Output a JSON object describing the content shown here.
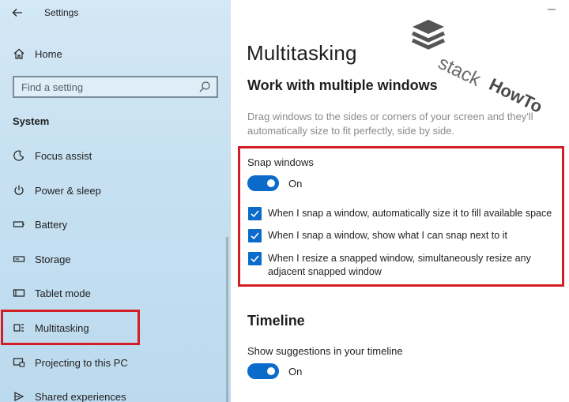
{
  "window": {
    "title": "Settings"
  },
  "sidebar": {
    "home_label": "Home",
    "search": {
      "placeholder": "Find a setting"
    },
    "section_label": "System",
    "items": [
      {
        "label": "Focus assist",
        "icon": "moon-icon"
      },
      {
        "label": "Power & sleep",
        "icon": "power-icon"
      },
      {
        "label": "Battery",
        "icon": "battery-icon"
      },
      {
        "label": "Storage",
        "icon": "storage-icon"
      },
      {
        "label": "Tablet mode",
        "icon": "tablet-mode-icon"
      },
      {
        "label": "Multitasking",
        "icon": "multitasking-icon",
        "selected": true
      },
      {
        "label": "Projecting to this PC",
        "icon": "projecting-icon"
      },
      {
        "label": "Shared experiences",
        "icon": "shared-experiences-icon"
      }
    ]
  },
  "main": {
    "title": "Multitasking",
    "section_heading": "Work with multiple windows",
    "description": "Drag windows to the sides or corners of your screen and they'll automatically size to fit perfectly, side by side.",
    "snap": {
      "label": "Snap windows",
      "toggle_state": "On",
      "toggle_on": true,
      "options": [
        {
          "label": "When I snap a window, automatically size it to fill available space",
          "checked": true
        },
        {
          "label": "When I snap a window, show what I can snap next to it",
          "checked": true
        },
        {
          "label": "When I resize a snapped window, simultaneously resize any adjacent snapped window",
          "checked": true
        }
      ]
    },
    "timeline": {
      "heading": "Timeline",
      "label": "Show suggestions in your timeline",
      "toggle_state": "On",
      "toggle_on": true
    }
  },
  "watermark": {
    "brand_a": "stack",
    "brand_b": "HowTo"
  },
  "colors": {
    "accent": "#0b6bcb",
    "highlight": "#d21e24",
    "sidebar_bg": "#c6e0f1"
  }
}
